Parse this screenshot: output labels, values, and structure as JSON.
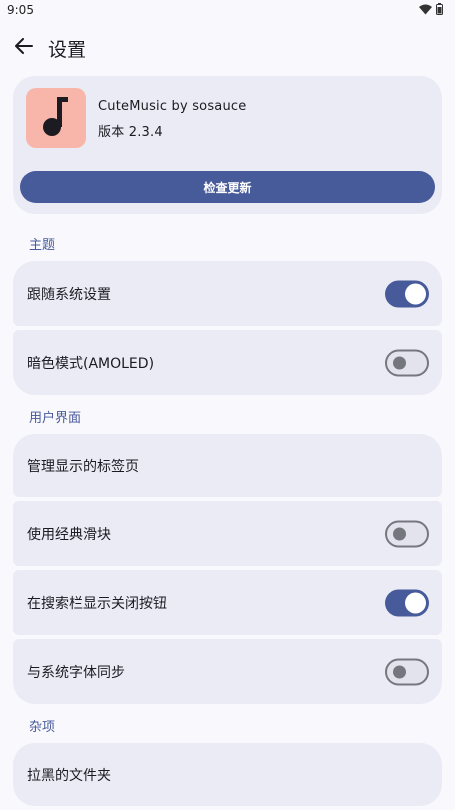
{
  "status_bar": {
    "time": "9:05"
  },
  "app_bar": {
    "title": "设置"
  },
  "about": {
    "app_name": "CuteMusic by sosauce",
    "version": "版本 2.3.4",
    "update_button": "检查更新"
  },
  "sections": {
    "theme": {
      "title": "主题",
      "items": [
        {
          "label": "跟随系统设置",
          "switch": "on"
        },
        {
          "label": "暗色模式(AMOLED)",
          "switch": "off"
        }
      ]
    },
    "ui": {
      "title": "用户界面",
      "items": [
        {
          "label": "管理显示的标签页"
        },
        {
          "label": "使用经典滑块",
          "switch": "off"
        },
        {
          "label": "在搜索栏显示关闭按钮",
          "switch": "on"
        },
        {
          "label": "与系统字体同步",
          "switch": "off"
        }
      ]
    },
    "misc": {
      "title": "杂项",
      "items": [
        {
          "label": "拉黑的文件夹"
        }
      ]
    }
  },
  "colors": {
    "accent": "#475a99",
    "card": "#eaebf5",
    "background": "#f8f8fd",
    "app_icon_bg": "#f8b5a9"
  }
}
